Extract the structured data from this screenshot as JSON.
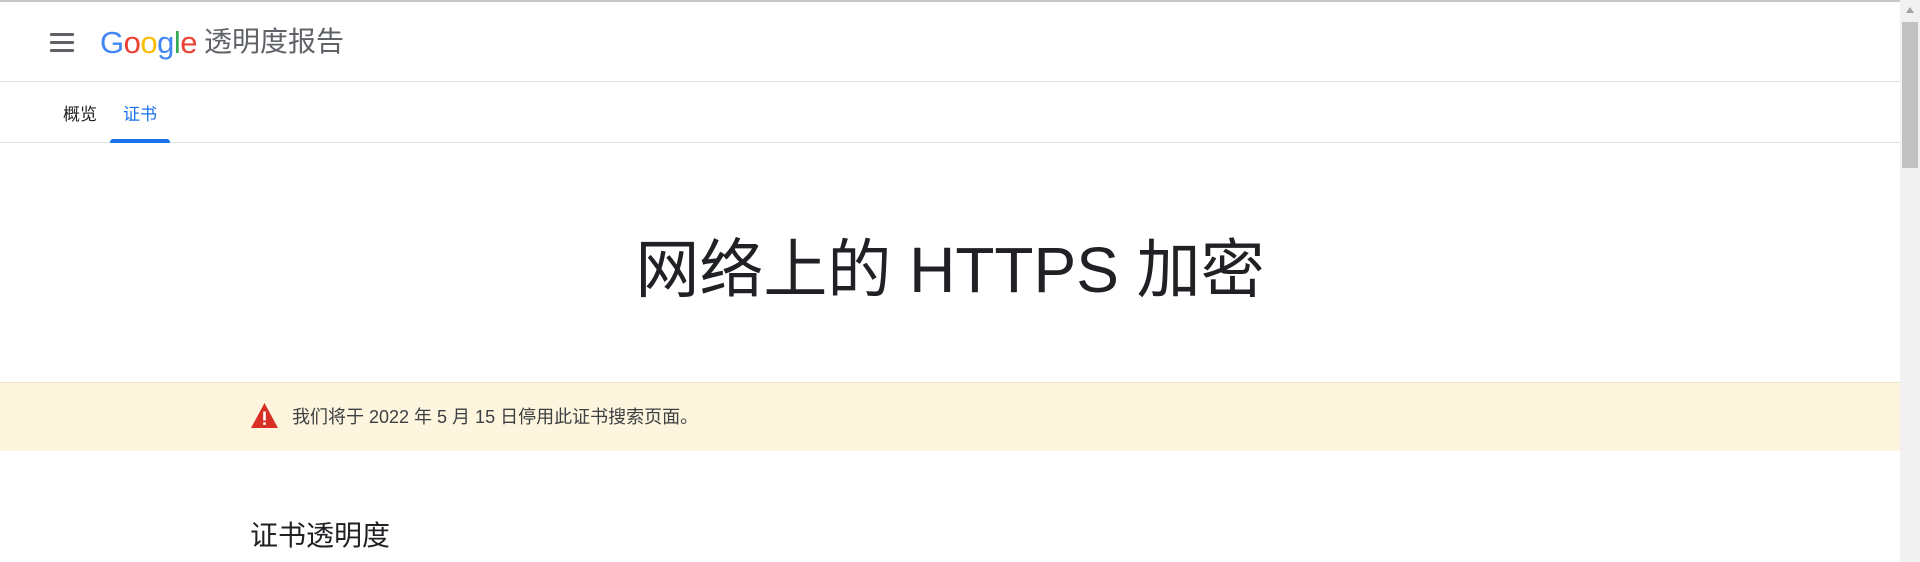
{
  "header": {
    "logo": {
      "letters": [
        "G",
        "o",
        "o",
        "g",
        "l",
        "e"
      ],
      "colors": [
        "#4285F4",
        "#EA4335",
        "#FBBC05",
        "#4285F4",
        "#34A853",
        "#EA4335"
      ]
    },
    "product_name": "透明度报告",
    "menu_icon": "hamburger-menu-icon"
  },
  "tabs": [
    {
      "label": "概览",
      "active": false
    },
    {
      "label": "证书",
      "active": true
    }
  ],
  "hero": {
    "title": "网络上的 HTTPS 加密"
  },
  "banner": {
    "icon": "warning-triangle-icon",
    "icon_color": "#d93025",
    "background": "#fdf5de",
    "text": "我们将于 2022 年 5 月 15 日停用此证书搜索页面。"
  },
  "section": {
    "heading": "证书透明度"
  },
  "colors": {
    "accent": "#1a73e8",
    "text_primary": "#202124",
    "text_secondary": "#5f6368"
  }
}
